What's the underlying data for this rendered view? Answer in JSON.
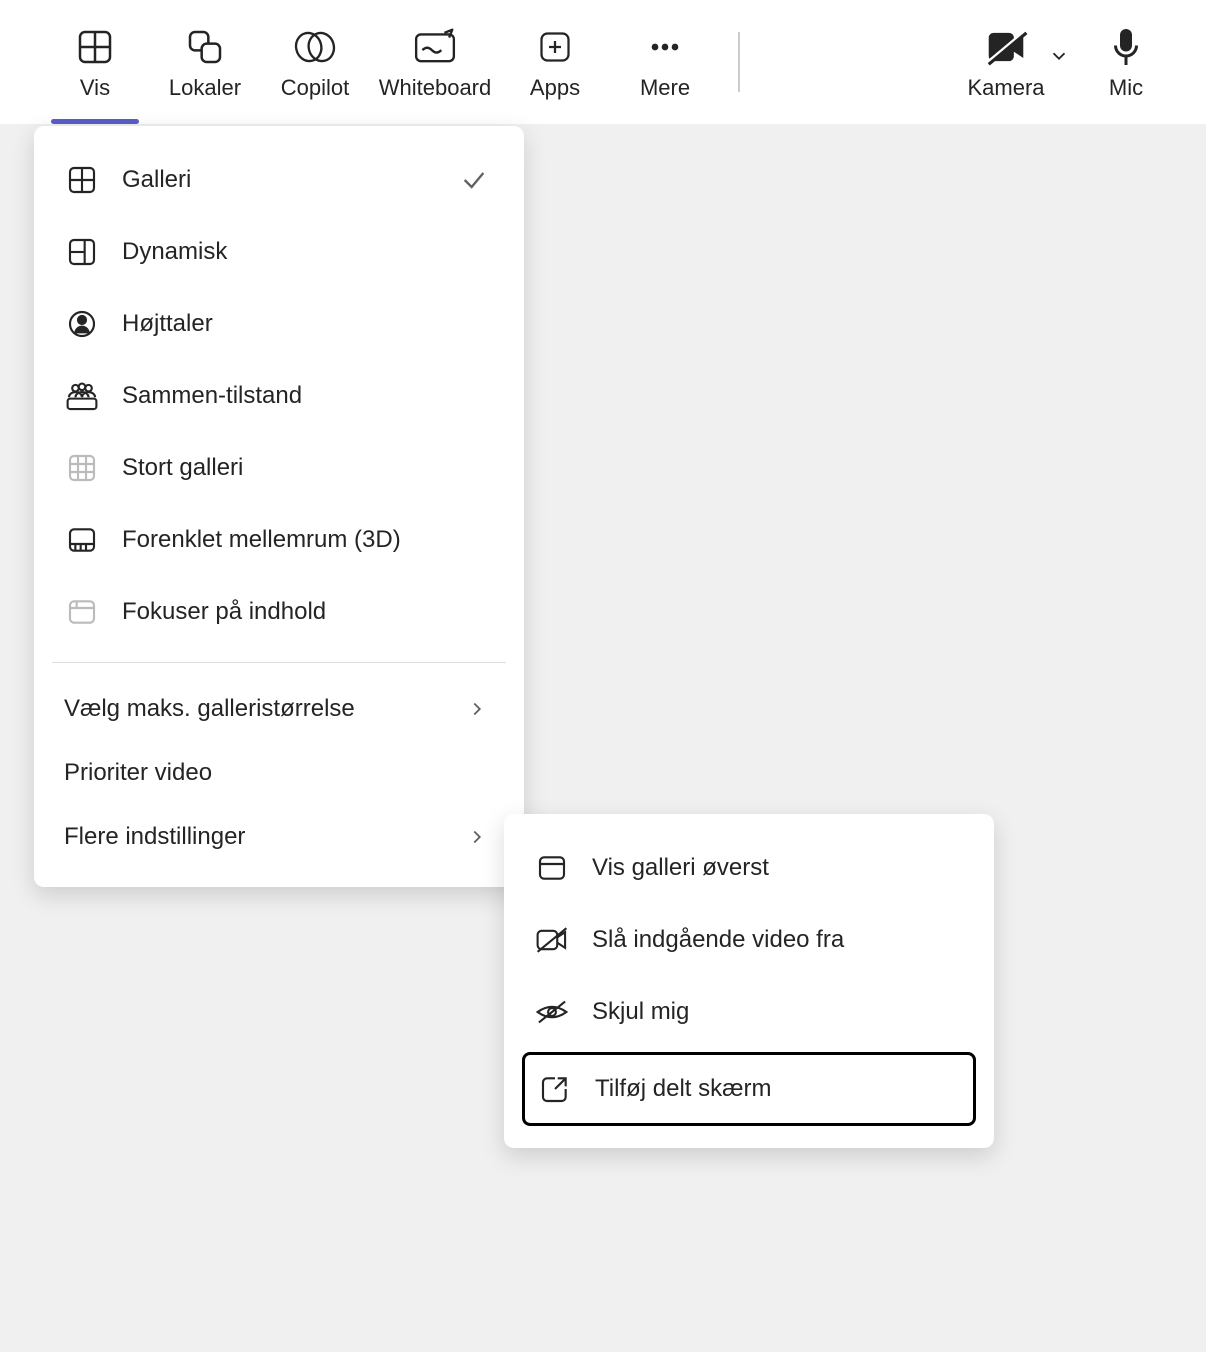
{
  "toolbar": {
    "items": [
      {
        "label": "Vis",
        "icon": "grid-icon",
        "active": true
      },
      {
        "label": "Lokaler",
        "icon": "rooms-icon",
        "active": false
      },
      {
        "label": "Copilot",
        "icon": "copilot-icon",
        "active": false
      },
      {
        "label": "Whiteboard",
        "icon": "whiteboard-icon",
        "active": false
      },
      {
        "label": "Apps",
        "icon": "apps-icon",
        "active": false
      },
      {
        "label": "Mere",
        "icon": "more-icon",
        "active": false
      }
    ],
    "right": [
      {
        "label": "Kamera",
        "icon": "camera-off-icon"
      },
      {
        "label": "Mic",
        "icon": "mic-icon"
      }
    ]
  },
  "menu": {
    "primary": [
      {
        "label": "Galleri",
        "icon": "gallery-icon",
        "checked": true
      },
      {
        "label": "Dynamisk",
        "icon": "dynamic-icon",
        "checked": false
      },
      {
        "label": "Højttaler",
        "icon": "speaker-person-icon",
        "checked": false
      },
      {
        "label": "Sammen-tilstand",
        "icon": "together-icon",
        "checked": false
      },
      {
        "label": "Stort galleri",
        "icon": "large-gallery-icon",
        "checked": false
      },
      {
        "label": "Forenklet mellemrum (3D)",
        "icon": "immersive-3d-icon",
        "checked": false
      },
      {
        "label": "Fokuser på indhold",
        "icon": "focus-content-icon",
        "checked": false
      }
    ],
    "secondary": [
      {
        "label": "Vælg maks. galleristørrelse",
        "submenu": true
      },
      {
        "label": "Prioriter video",
        "submenu": false
      },
      {
        "label": "Flere indstillinger",
        "submenu": true
      }
    ]
  },
  "submenu": {
    "items": [
      {
        "label": "Vis galleri øverst",
        "icon": "gallery-top-icon",
        "highlighted": false
      },
      {
        "label": "Slå indgående video fra",
        "icon": "incoming-video-off-icon",
        "highlighted": false
      },
      {
        "label": "Skjul mig",
        "icon": "hide-me-icon",
        "highlighted": false
      },
      {
        "label": "Tilføj delt skærm",
        "icon": "pop-out-icon",
        "highlighted": true
      }
    ]
  }
}
